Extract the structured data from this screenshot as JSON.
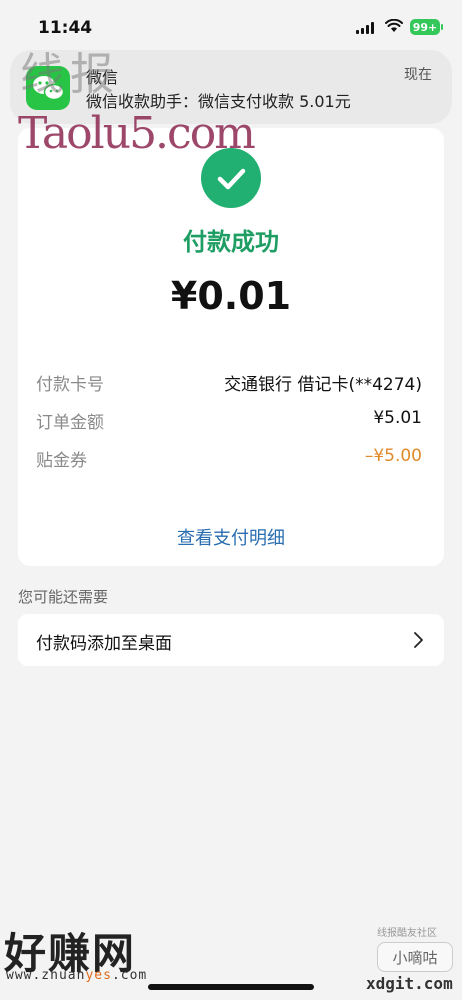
{
  "status_bar": {
    "time": "11:44",
    "battery": "99+"
  },
  "notification": {
    "app": "微信",
    "message": "微信收款助手：微信支付收款 5.01元",
    "time": "现在",
    "icon": "wechat-icon"
  },
  "payment": {
    "status": "付款成功",
    "amount": "¥0.01",
    "rows": [
      {
        "label": "付款卡号",
        "value": "交通银行 借记卡(**4274)"
      },
      {
        "label": "订单金额",
        "value": "¥5.01"
      },
      {
        "label": "贴金券",
        "value": "–¥5.00"
      }
    ],
    "detail_link": "查看支付明细"
  },
  "suggestions": {
    "heading": "您可能还需要",
    "items": [
      {
        "label": "付款码添加至桌面"
      }
    ]
  },
  "watermarks": {
    "top": "线报",
    "taolu": "Taolu5.com",
    "haozhuan": "好赚网",
    "haozhuan_url_a": "www.zhuan",
    "haozhuan_url_b": "yes",
    "haozhuan_url_c": ".com",
    "xdg_small": "线报酷友社区",
    "xdg_box": "小嘀咕",
    "xdg_url": "xdgit.com"
  },
  "colors": {
    "success": "#21b072",
    "link": "#2a6db0",
    "discount": "#e08a2b",
    "wechat": "#28c445"
  }
}
